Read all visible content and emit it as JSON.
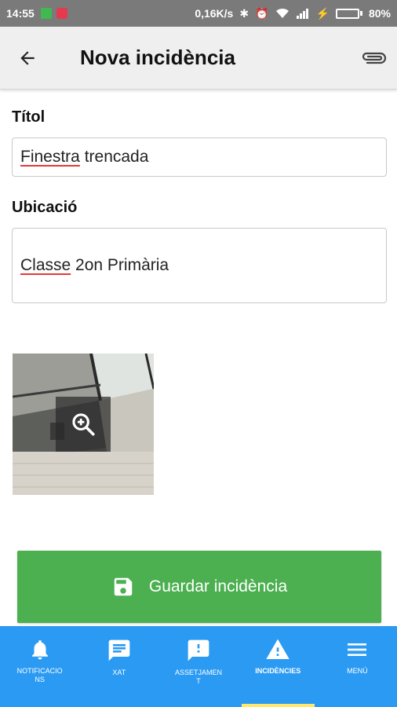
{
  "status_bar": {
    "time": "14:55",
    "speed": "0,16K/s",
    "battery": "80%",
    "battery_level": 0.8
  },
  "app_bar": {
    "title": "Nova incidència"
  },
  "form": {
    "title_label": "Títol",
    "title_value_word1": "Finestra",
    "title_value_rest": " trencada",
    "location_label": "Ubicació",
    "location_value_word1": "Classe",
    "location_value_rest": " 2on Primària"
  },
  "save_button": {
    "label": "Guardar incidència"
  },
  "bottom_nav": {
    "items": [
      {
        "label": "NOTIFICACIONS",
        "icon": "bell-icon"
      },
      {
        "label": "XAT",
        "icon": "chat-icon"
      },
      {
        "label": "ASSETJAMENT",
        "icon": "alert-chat-icon"
      },
      {
        "label": "INCIDÈNCIES",
        "icon": "warning-icon",
        "active": true
      },
      {
        "label": "MENÚ",
        "icon": "menu-icon"
      }
    ]
  },
  "colors": {
    "primary": "#2b9af3",
    "save": "#4caf50",
    "active_indicator": "#ffe86b",
    "spell_error": "#e53935"
  }
}
